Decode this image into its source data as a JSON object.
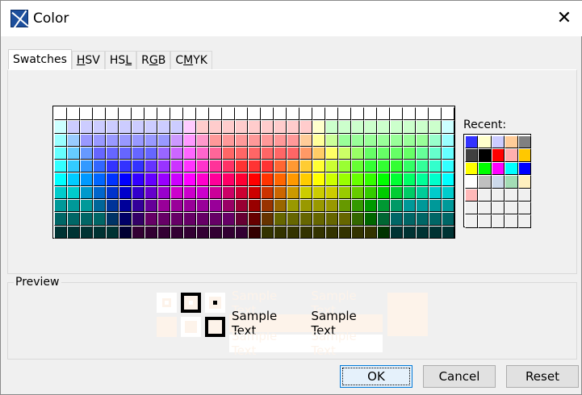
{
  "window": {
    "title": "Color",
    "close_glyph": "✕"
  },
  "tabs": [
    {
      "label": "Swatches",
      "mnemonic": ""
    },
    {
      "label": "HSV",
      "mnemonic": "H"
    },
    {
      "label": "HSL",
      "mnemonic": "L"
    },
    {
      "label": "RGB",
      "mnemonic": "G"
    },
    {
      "label": "CMYK",
      "mnemonic": "M"
    }
  ],
  "swatches": {
    "rows": [
      [
        "FFFFFF",
        "FFFFFF",
        "FFFFFF",
        "FFFFFF",
        "FFFFFF",
        "FFFFFF",
        "FFFFFF",
        "FFFFFF",
        "FFFFFF",
        "FFFFFF",
        "FFFFFF",
        "FFFFFF",
        "FFFFFF",
        "FFFFFF",
        "FFFFFF",
        "FFFFFF",
        "FFFFFF",
        "FFFFFF",
        "FFFFFF",
        "FFFFFF",
        "FFFFFF",
        "FFFFFF",
        "FFFFFF",
        "FFFFFF",
        "FFFFFF",
        "FFFFFF",
        "FFFFFF",
        "FFFFFF",
        "FFFFFF",
        "FFFFFF",
        "FFFFFF"
      ],
      [
        "CCFFFF",
        "CCCCFF",
        "CCCCFF",
        "CCCCFF",
        "CCCCFF",
        "CCCCFF",
        "CCCCFF",
        "CCCCFF",
        "CCCCFF",
        "CCCCFF",
        "FFCCFF",
        "FFCCCC",
        "FFCCCC",
        "FFCCCC",
        "FFCCCC",
        "FFCCCC",
        "FFCCCC",
        "FFCCCC",
        "FFCCCC",
        "FFCCCC",
        "FFFFCC",
        "CCFFCC",
        "CCFFCC",
        "CCFFCC",
        "CCFFCC",
        "CCFFCC",
        "CCFFCC",
        "CCFFCC",
        "CCFFCC",
        "CCFFCC",
        "CCFFFF"
      ],
      [
        "99FFFF",
        "99CCFF",
        "9999FF",
        "9999FF",
        "9999FF",
        "9999FF",
        "9999FF",
        "9999FF",
        "9999FF",
        "CC99FF",
        "FF99FF",
        "FF99CC",
        "FF9999",
        "FF9999",
        "FF9999",
        "FF9999",
        "FF9999",
        "FF9999",
        "FF9999",
        "FFCC99",
        "FFFF99",
        "CCFF99",
        "99FF99",
        "99FF99",
        "99FF99",
        "99FF99",
        "99FF99",
        "99FF99",
        "99FF99",
        "99FFCC",
        "99FFFF"
      ],
      [
        "66FFFF",
        "66CCFF",
        "6699FF",
        "6666FF",
        "6666FF",
        "6666FF",
        "6666FF",
        "6666FF",
        "9966FF",
        "CC66FF",
        "FF66FF",
        "FF66CC",
        "FF6699",
        "FF6666",
        "FF6666",
        "FF6666",
        "FF6666",
        "FF6666",
        "FF6666",
        "FF9966",
        "FFCC66",
        "FFFF66",
        "CCFF66",
        "99FF66",
        "66FF66",
        "66FF66",
        "66FF66",
        "66FF66",
        "66FF99",
        "66FFCC",
        "66FFFF"
      ],
      [
        "33FFFF",
        "33CCFF",
        "3399FF",
        "3366FF",
        "3333FF",
        "3333FF",
        "3333FF",
        "6633FF",
        "9933FF",
        "CC33FF",
        "FF33FF",
        "FF33CC",
        "FF3399",
        "FF3366",
        "FF3333",
        "FF3333",
        "FF3333",
        "FF6633",
        "FF9933",
        "FFCC33",
        "FFFF33",
        "CCFF33",
        "99FF33",
        "66FF33",
        "33FF33",
        "33FF33",
        "33FF33",
        "33FF66",
        "33FF99",
        "33FFCC",
        "33FFFF"
      ],
      [
        "00FFFF",
        "00CCFF",
        "0099FF",
        "0066FF",
        "0033FF",
        "0000FF",
        "3300FF",
        "6600FF",
        "9900FF",
        "CC00FF",
        "FF00FF",
        "FF00CC",
        "FF0099",
        "FF0066",
        "FF0033",
        "FF0000",
        "FF3300",
        "FF6600",
        "FF9900",
        "FFCC00",
        "FFFF00",
        "CCFF00",
        "99FF00",
        "66FF00",
        "33FF00",
        "00FF00",
        "00FF33",
        "00FF66",
        "00FF99",
        "00FFCC",
        "00FFFF"
      ],
      [
        "00CCCC",
        "00CCCC",
        "0099CC",
        "0066CC",
        "0033CC",
        "0000CC",
        "3300CC",
        "6600CC",
        "9900CC",
        "CC00CC",
        "CC00CC",
        "CC00CC",
        "CC0099",
        "CC0066",
        "CC0033",
        "CC0000",
        "CC3300",
        "CC6600",
        "CC9900",
        "CCCC00",
        "CCCC00",
        "CCCC00",
        "99CC00",
        "66CC00",
        "33CC00",
        "00CC00",
        "00CC33",
        "00CC66",
        "00CC99",
        "00CCCC",
        "00CCCC"
      ],
      [
        "009999",
        "009999",
        "009999",
        "006699",
        "003399",
        "000099",
        "330099",
        "660099",
        "990099",
        "990099",
        "990099",
        "990099",
        "990099",
        "990066",
        "990033",
        "990000",
        "993300",
        "996600",
        "999900",
        "999900",
        "999900",
        "999900",
        "669900",
        "339900",
        "009900",
        "009933",
        "009966",
        "009999",
        "009999",
        "009999",
        "009999"
      ],
      [
        "006666",
        "006666",
        "006666",
        "006666",
        "003366",
        "000066",
        "330066",
        "660066",
        "660066",
        "660066",
        "660066",
        "660066",
        "660066",
        "660066",
        "660033",
        "660000",
        "663300",
        "666600",
        "666600",
        "666600",
        "666600",
        "666600",
        "666600",
        "336600",
        "006600",
        "006633",
        "006666",
        "006666",
        "006666",
        "006666",
        "006666"
      ],
      [
        "003333",
        "003333",
        "003333",
        "003333",
        "003333",
        "000033",
        "330033",
        "330033",
        "330033",
        "330033",
        "330033",
        "330033",
        "330033",
        "330033",
        "330033",
        "330000",
        "333300",
        "333300",
        "333300",
        "333300",
        "333300",
        "333300",
        "333300",
        "333300",
        "333300",
        "003300",
        "003333",
        "003333",
        "003333",
        "003333",
        "003333"
      ]
    ]
  },
  "recent": {
    "label": "Recent:",
    "colors": [
      "3333FF",
      "FFFFCC",
      "CCCCFF",
      "FFCC99",
      "808080",
      "404040",
      "000000",
      "FF0000",
      "FFAFAF",
      "FFC800",
      "FFFF00",
      "00FF00",
      "FF00FF",
      "00FFFF",
      "0000FF",
      "FFFFFF",
      "C0C0C0",
      "CCD9EA",
      "A3DDB5",
      "FFF0BF",
      "FFB8B8"
    ],
    "empty_color": "F0F0F0",
    "total_cells": 35
  },
  "preview": {
    "label": "Preview",
    "sample_text": "Sample Text",
    "selected_color": "#FDF3EA"
  },
  "buttons": {
    "ok": "OK",
    "cancel": "Cancel",
    "reset": "Reset"
  }
}
